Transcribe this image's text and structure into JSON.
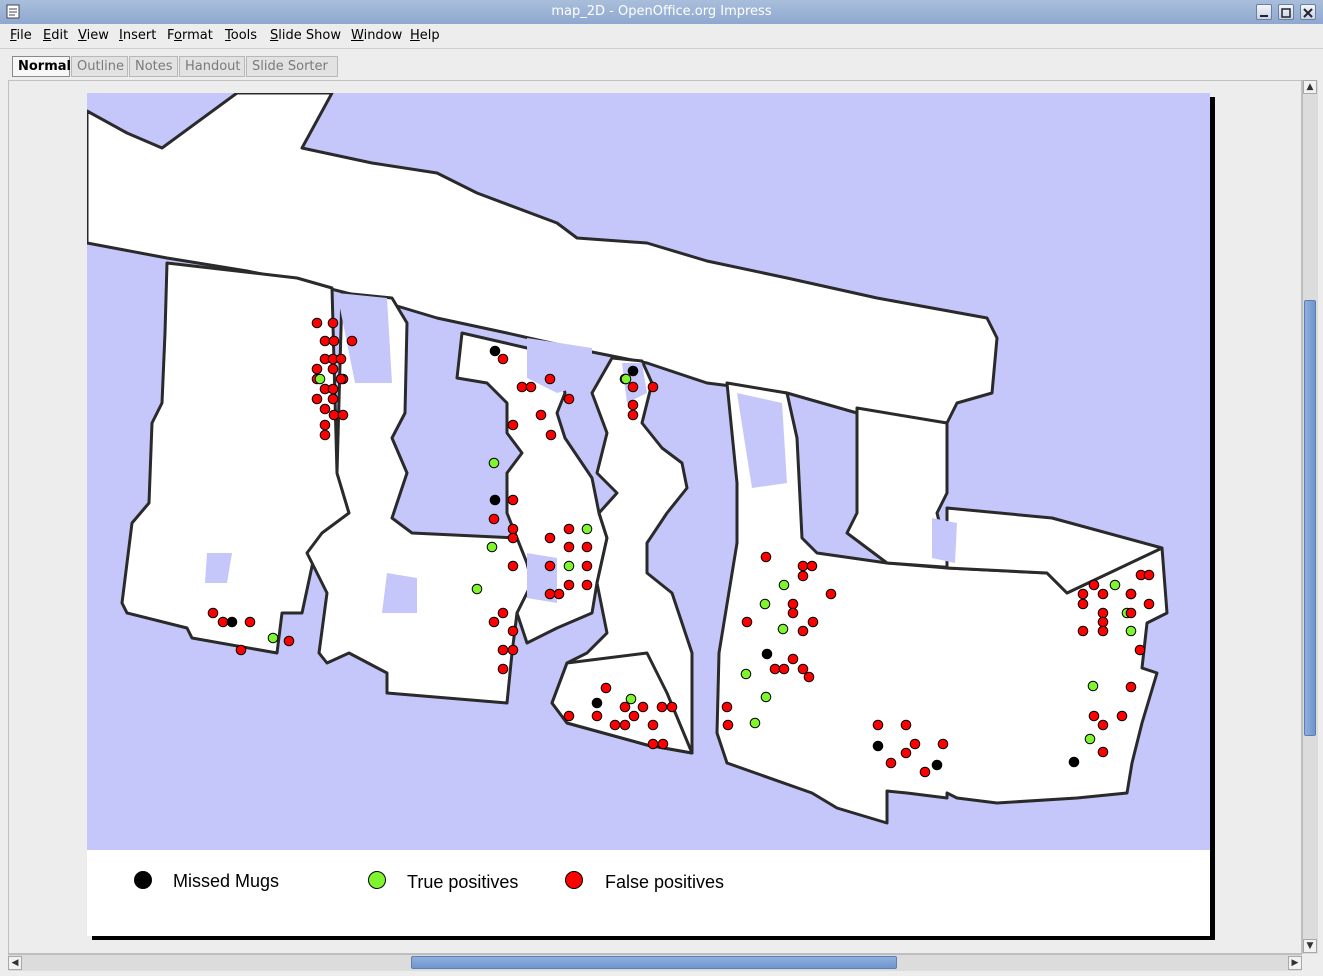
{
  "window": {
    "title": "map_2D - OpenOffice.org Impress",
    "buttons": [
      "minimize-icon",
      "maximize-icon",
      "close-icon"
    ]
  },
  "menu": [
    "File",
    "Edit",
    "View",
    "Insert",
    "Format",
    "Tools",
    "Slide Show",
    "Window",
    "Help"
  ],
  "menu_mnemonics": [
    "F",
    "E",
    "V",
    "I",
    "o",
    "T",
    "S",
    "W",
    "H"
  ],
  "view_tabs": [
    "Normal",
    "Outline",
    "Notes",
    "Handout",
    "Slide Sorter"
  ],
  "active_tab": "Normal",
  "legend": {
    "missed": "Missed Mugs",
    "true_pos": "True positives",
    "false_pos": "False positives"
  },
  "colors": {
    "map_background": "#c5c7fb",
    "free_space": "#ffffff",
    "missed": "#000000",
    "true_positive": "#7ff530",
    "false_positive": "#ff0000"
  }
}
